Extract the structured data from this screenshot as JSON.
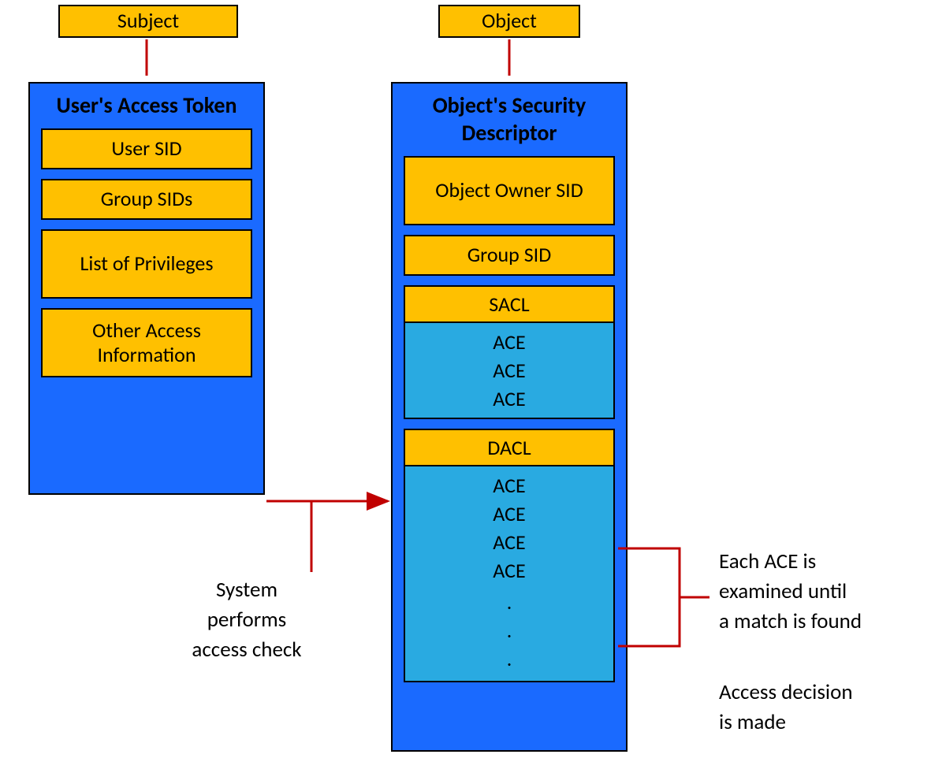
{
  "subject_label": "Subject",
  "object_label": "Object",
  "token": {
    "title": "User's Access Token",
    "user_sid": "User SID",
    "group_sids": "Group SIDs",
    "privileges": "List of Privileges",
    "other": "Other Access Information"
  },
  "descriptor": {
    "title": "Object's Security Descriptor",
    "owner": "Object Owner SID",
    "group": "Group SID",
    "sacl_label": "SACL",
    "sacl_aces": [
      "ACE",
      "ACE",
      "ACE"
    ],
    "dacl_label": "DACL",
    "dacl_aces": [
      "ACE",
      "ACE",
      "ACE",
      "ACE",
      ".",
      ".",
      "."
    ]
  },
  "caption_check_l1": "System",
  "caption_check_l2": "performs",
  "caption_check_l3": "access check",
  "caption_examine_l1": "Each ACE is",
  "caption_examine_l2": "examined until",
  "caption_examine_l3": "a match is found",
  "caption_decision_l1": "Access decision",
  "caption_decision_l2": "is made"
}
